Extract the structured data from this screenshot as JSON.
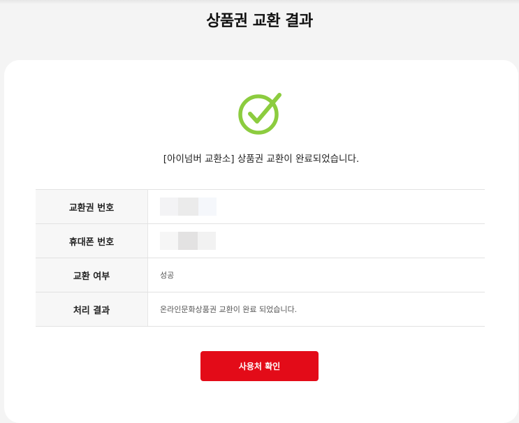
{
  "page": {
    "title": "상품권 교환 결과"
  },
  "result": {
    "message": "[아이넘버 교환소] 상품권 교환이 완료되었습니다.",
    "rows": [
      {
        "label": "교환권 번호",
        "value": ""
      },
      {
        "label": "휴대폰 번호",
        "value": ""
      },
      {
        "label": "교환 여부",
        "value": "성공"
      },
      {
        "label": "처리 결과",
        "value": "온라인문화상품권 교환이 완료 되었습니다."
      }
    ]
  },
  "actions": {
    "confirm_label": "사용처 확인"
  },
  "icons": {
    "status": "check-circle-icon"
  },
  "colors": {
    "accent": "#e30b18",
    "success": "#8ccc3f"
  }
}
